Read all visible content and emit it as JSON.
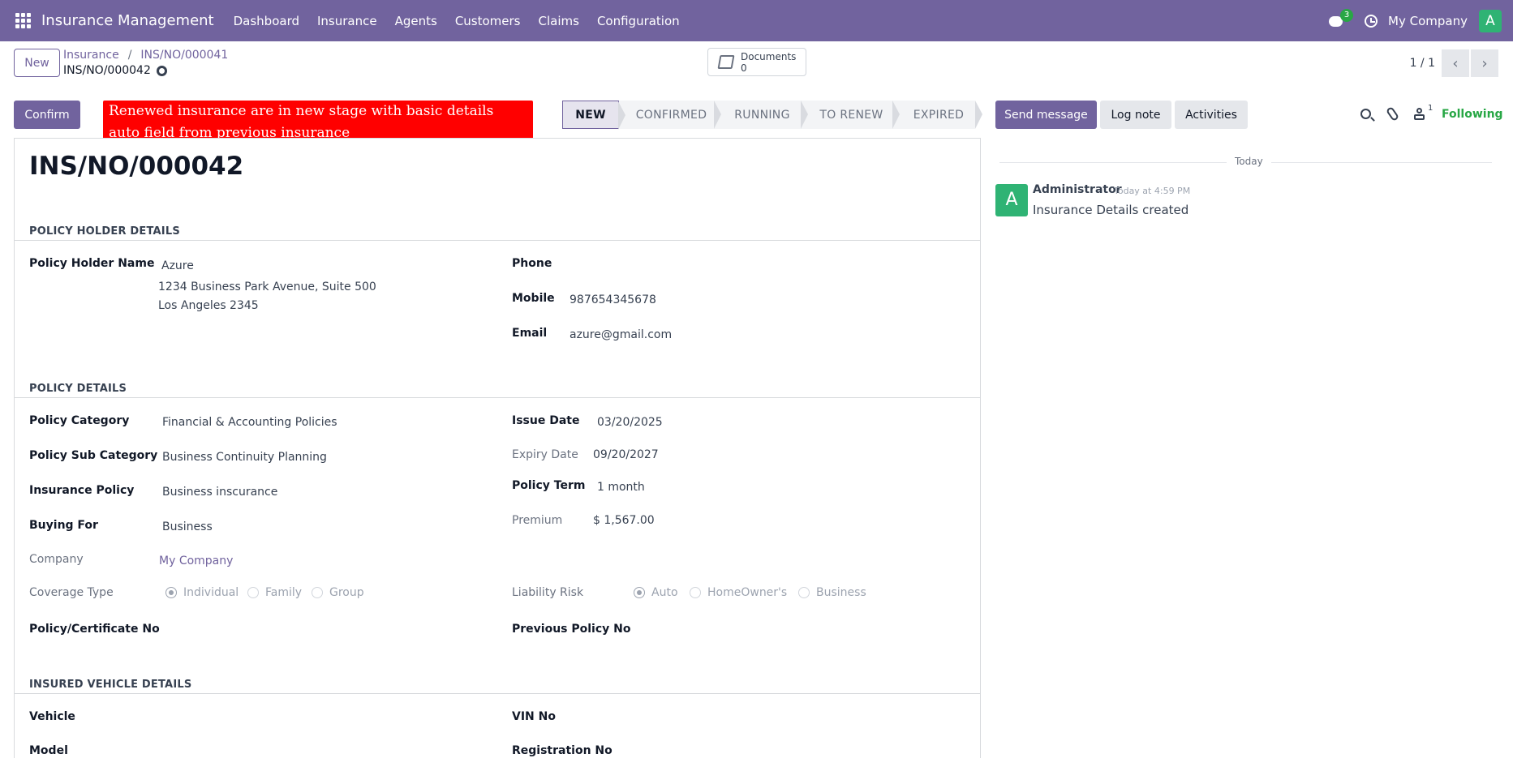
{
  "navbar": {
    "app_title": "Insurance Management",
    "menu": [
      "Dashboard",
      "Insurance",
      "Agents",
      "Customers",
      "Claims",
      "Configuration"
    ],
    "messages_badge": "3",
    "company": "My Company",
    "user_initial": "A"
  },
  "control": {
    "new_label": "New",
    "breadcrumb_parent": "Insurance",
    "breadcrumb_separator": "/",
    "breadcrumb_previous": "INS/NO/000041",
    "record_name": "INS/NO/000042",
    "documents_label": "Documents",
    "documents_count": "0",
    "pager": "1 / 1"
  },
  "statusbar": {
    "confirm_label": "Confirm",
    "annotation": "Renewed insurance are in new stage with basic details auto field from previous insurance",
    "stages": [
      "NEW",
      "CONFIRMED",
      "RUNNING",
      "TO RENEW",
      "EXPIRED"
    ],
    "active_stage": "NEW"
  },
  "form": {
    "title": "INS/NO/000042",
    "policy_holder": {
      "section": "POLICY HOLDER DETAILS",
      "name_label": "Policy Holder Name",
      "name": "Azure",
      "address_line1": "1234 Business Park Avenue, Suite 500",
      "address_line2": "Los Angeles 2345",
      "phone_label": "Phone",
      "phone": "",
      "mobile_label": "Mobile",
      "mobile": "987654345678",
      "email_label": "Email",
      "email": "azure@gmail.com"
    },
    "policy": {
      "section": "POLICY DETAILS",
      "category_label": "Policy Category",
      "category": "Financial & Accounting Policies",
      "sub_category_label": "Policy Sub Category",
      "sub_category": "Business Continuity Planning",
      "insurance_policy_label": "Insurance Policy",
      "insurance_policy": "Business inscurance",
      "buying_for_label": "Buying For",
      "buying_for": "Business",
      "company_label": "Company",
      "company": "My Company",
      "coverage_label": "Coverage Type",
      "coverage_options": [
        "Individual",
        "Family",
        "Group"
      ],
      "coverage_selected": "Individual",
      "certificate_label": "Policy/Certificate No",
      "issue_date_label": "Issue Date",
      "issue_date": "03/20/2025",
      "expiry_date_label": "Expiry Date",
      "expiry_date": "09/20/2027",
      "term_label": "Policy Term",
      "term": "1 month",
      "premium_label": "Premium",
      "premium": "$ 1,567.00",
      "liability_label": "Liability Risk",
      "liability_options": [
        "Auto",
        "HomeOwner's",
        "Business"
      ],
      "liability_selected": "Auto",
      "previous_policy_label": "Previous Policy No"
    },
    "vehicle": {
      "section": "INSURED VEHICLE DETAILS",
      "vehicle_label": "Vehicle",
      "model_label": "Model",
      "vin_label": "VIN No",
      "registration_label": "Registration No"
    }
  },
  "chatter": {
    "send_message": "Send message",
    "log_note": "Log note",
    "activities": "Activities",
    "followers_count": "1",
    "following": "Following",
    "date_separator": "Today",
    "message": {
      "avatar_initial": "A",
      "author": "Administrator",
      "time": "Today at 4:59 PM",
      "body": "Insurance Details created"
    }
  }
}
